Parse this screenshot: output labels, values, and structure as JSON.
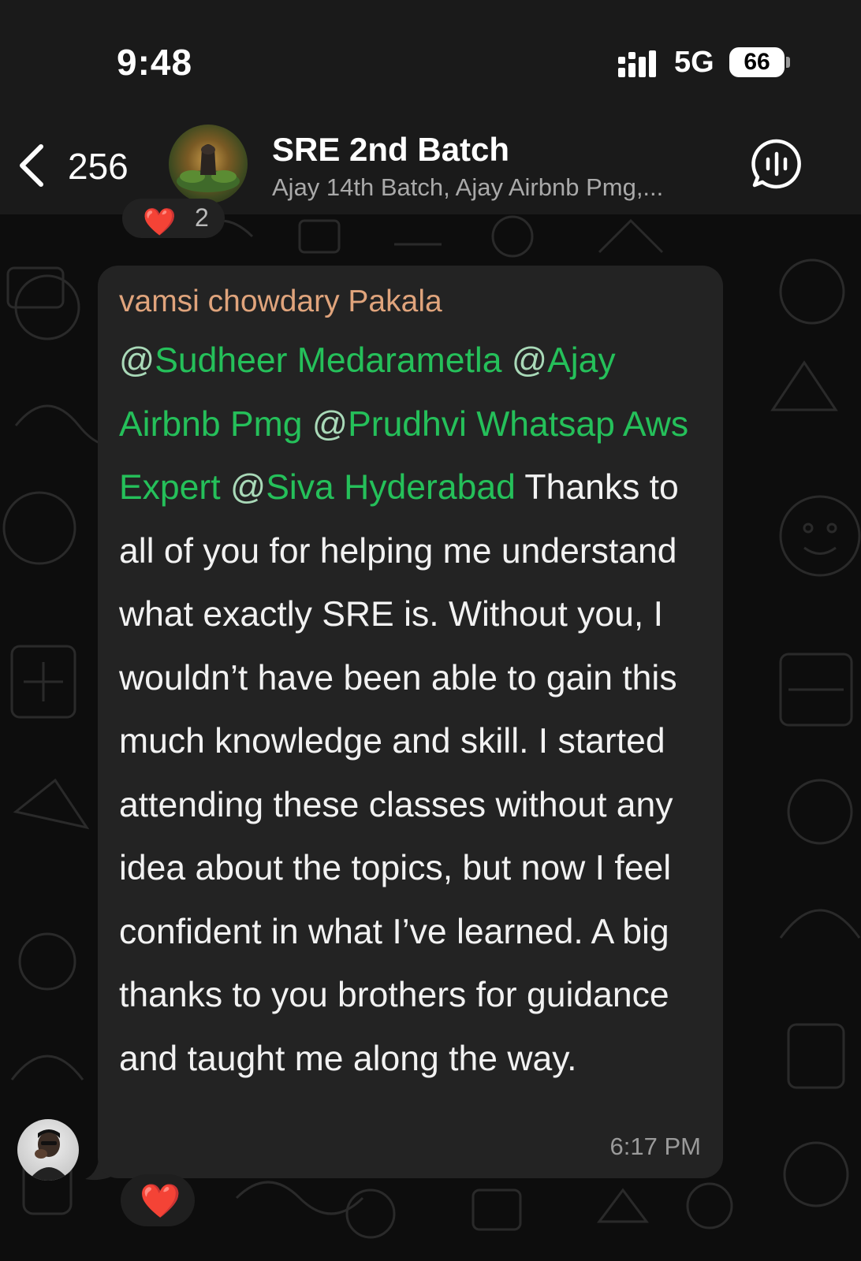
{
  "status_bar": {
    "time": "9:48",
    "network": "5G",
    "battery": "66"
  },
  "header": {
    "back_count": "256",
    "title": "SRE 2nd Batch",
    "subtitle": "Ajay 14th Batch, Ajay Airbnb Pmg,..."
  },
  "top_reaction": {
    "emoji": "❤️",
    "count": "2"
  },
  "message": {
    "sender": "vamsi chowdary Pakala",
    "mentions": [
      "Sudheer Medarametla",
      "Ajay Airbnb Pmg",
      "Prudhvi Whatsap Aws Expert",
      "Siva Hyderabad"
    ],
    "text": "Thanks to all of you for helping me understand what exactly SRE is. Without you, I wouldn’t have been able to gain this much knowledge and skill. I started attending these classes without any idea about the topics, but now I feel confident in what I’ve learned. A big thanks to you brothers for guidance and taught me along the way.",
    "time": "6:17 PM"
  },
  "bottom_reaction": {
    "emoji": "❤️"
  },
  "colors": {
    "mention": "#25c05a",
    "sender_name": "#e0a47c",
    "bubble": "#232323",
    "header_bg": "#1a1a1a"
  },
  "icons": {
    "back": "chevron-left-icon",
    "voice_chat": "voice-chat-icon",
    "signal": "signal-icon"
  }
}
